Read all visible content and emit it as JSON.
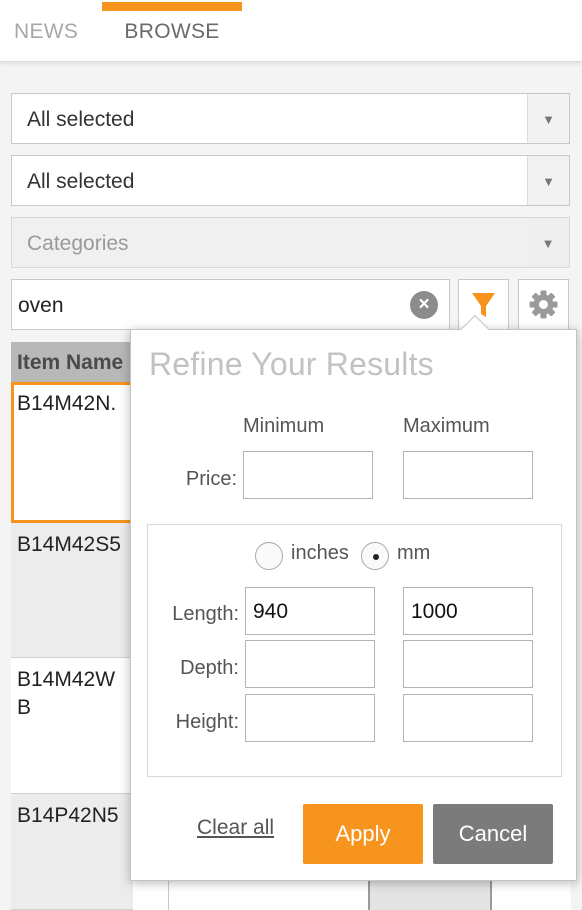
{
  "tabs": [
    {
      "label": "NEWS",
      "active": false
    },
    {
      "label": "BROWSE",
      "active": true
    }
  ],
  "filters": {
    "select1": {
      "value": "All selected"
    },
    "select2": {
      "value": "All selected"
    },
    "categories": {
      "placeholder": "Categories"
    }
  },
  "search": {
    "value": "oven"
  },
  "icons": {
    "filter": "filter-funnel-icon",
    "settings": "gear-icon",
    "clear": "clear-x-icon",
    "dropdown": "chevron-down-icon"
  },
  "colors": {
    "accent": "#f7941d",
    "cancel": "#7b7b7b",
    "header": "#b8b8b8"
  },
  "table": {
    "header": "Item Name",
    "rows": [
      {
        "name": "B14M42N.",
        "selected": true
      },
      {
        "name": "B14M42S5",
        "selected": false
      },
      {
        "name": "B14M42W\nB",
        "selected": false
      },
      {
        "name": "B14P42N5",
        "selected": false
      }
    ]
  },
  "refine": {
    "title": "Refine Your Results",
    "min_label": "Minimum",
    "max_label": "Maximum",
    "price_label": "Price:",
    "price_min": "",
    "price_max": "",
    "unit_inches": "inches",
    "unit_mm": "mm",
    "selected_unit": "mm",
    "length_label": "Length:",
    "length_min": "940",
    "length_max": "1000",
    "depth_label": "Depth:",
    "depth_min": "",
    "depth_max": "",
    "height_label": "Height:",
    "height_min": "",
    "height_max": "",
    "clear_all": "Clear all",
    "apply": "Apply",
    "cancel": "Cancel"
  }
}
